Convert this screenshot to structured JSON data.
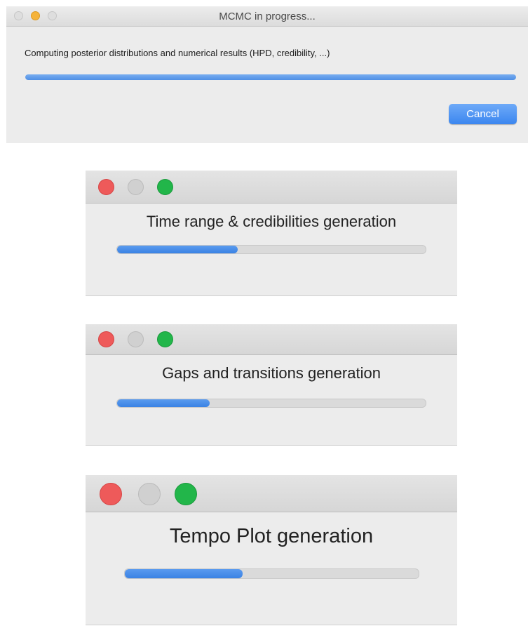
{
  "main_window": {
    "title": "MCMC in progress...",
    "message": "Computing posterior distributions and numerical results (HPD, credibility, ...)",
    "progress": 1.0,
    "cancel_label": "Cancel",
    "traffic_lights": [
      "close-inactive",
      "minimize-active",
      "zoom-inactive"
    ]
  },
  "sub_windows": [
    {
      "heading": "Time range & credibilities generation",
      "progress": 0.39
    },
    {
      "heading": "Gaps and transitions generation",
      "progress": 0.3
    },
    {
      "heading": "Tempo Plot generation",
      "progress": 0.4
    }
  ],
  "colors": {
    "accent_blue": "#4a8ce8",
    "close_red": "#ee5a5a",
    "zoom_green": "#22b64a",
    "minimize_yellow": "#f5b33a",
    "window_bg": "#ececec"
  }
}
